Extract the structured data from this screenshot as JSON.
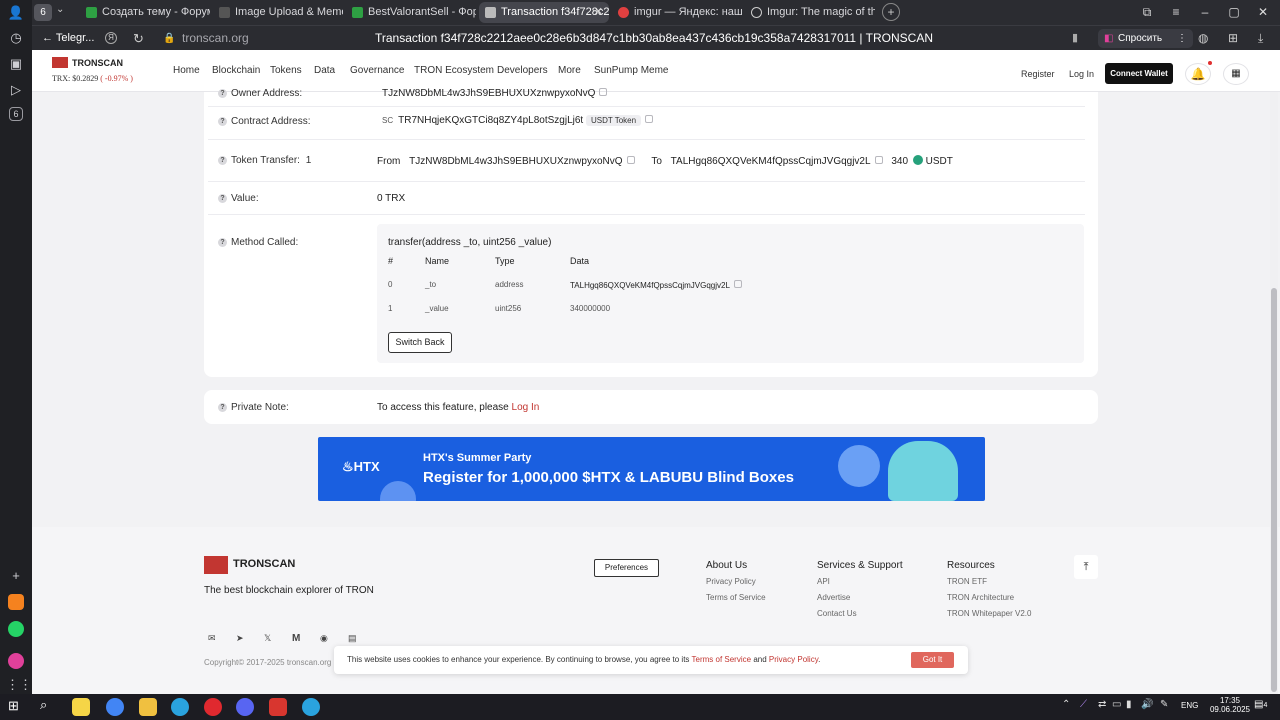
{
  "browser": {
    "tab_count": "6",
    "tabs": [
      {
        "label": "Создать тему - Форум со",
        "color": "#2ea043"
      },
      {
        "label": "Image Upload & Meme Ge",
        "color": "#555"
      },
      {
        "label": "BestValorantSell - Форум",
        "color": "#2ea043"
      },
      {
        "label": "Transaction f34f728c22",
        "color": "#aaa"
      },
      {
        "label": "imgur — Яндекс: нашлос",
        "color": "#e04040"
      },
      {
        "label": "Imgur: The magic of the In",
        "color": "#444"
      }
    ],
    "back_label": "Telegr...",
    "url": "tronscan.org",
    "page_title": "Transaction f34f728c2212aee0c28e6b3d847c1bb30ab8ea437c436cb19c358a7428317011 | TRONSCAN",
    "ask_button": "Спросить"
  },
  "site": {
    "logo": "TRONSCAN",
    "price_label": "TRX: $0.2829",
    "price_change": "( -0.97% )",
    "nav": [
      "Home",
      "Blockchain",
      "Tokens",
      "Data",
      "Governance",
      "TRON Ecosystem",
      "Developers",
      "More",
      "SunPump Meme"
    ],
    "register": "Register",
    "login": "Log In",
    "connect_wallet": "Connect Wallet"
  },
  "tx": {
    "owner_label": "Owner Address:",
    "owner_value": "TJzNW8DbML4w3JhS9EBHUXUXznwpyxoNvQ",
    "contract_label": "Contract Address:",
    "contract_prefix": "SC",
    "contract_value": "TR7NHqjeKQxGTCi8q8ZY4pL8otSzgjLj6t",
    "contract_tag": "USDT Token",
    "transfer_label": "Token Transfer:",
    "transfer_count": "1",
    "from_label": "From",
    "from_value": "TJzNW8DbML4w3JhS9EBHUXUXznwpyxoNvQ",
    "to_label": "To",
    "to_value": "TALHgq86QXQVeKM4fQpssCqjmJVGqgjv2L",
    "amount": "340",
    "token": "USDT",
    "value_label": "Value:",
    "value": "0 TRX",
    "method_label": "Method Called:",
    "method_sig": "transfer(address _to, uint256 _value)",
    "method_headers": [
      "#",
      "Name",
      "Type",
      "Data"
    ],
    "method_rows": [
      [
        "0",
        "_to",
        "address",
        "TALHgq86QXQVeKM4fQpssCqjmJVGqgjv2L"
      ],
      [
        "1",
        "_value",
        "uint256",
        "340000000"
      ]
    ],
    "switch_back": "Switch Back",
    "note_label": "Private Note:",
    "note_text": "To access this feature, please",
    "note_link": "Log In"
  },
  "banner": {
    "brand": "HTX",
    "line1": "HTX's Summer Party",
    "line2": "Register for 1,000,000 $HTX & LABUBU Blind Boxes"
  },
  "footer": {
    "logo": "TRONSCAN",
    "tagline": "The best blockchain explorer of TRON",
    "preferences": "Preferences",
    "about_h": "About Us",
    "about_links": [
      "Privacy Policy",
      "Terms of Service"
    ],
    "services_h": "Services & Support",
    "services_links": [
      "API",
      "Advertise",
      "Contact Us"
    ],
    "resources_h": "Resources",
    "resources_links": [
      "TRON ETF",
      "TRON Architecture",
      "TRON Whitepaper V2.0"
    ],
    "copyright": "Copyright© 2017-2025 tronscan.org"
  },
  "cookie": {
    "text": "This website uses cookies to enhance your experience. By continuing to browse, you agree to its",
    "terms": "Terms of Service",
    "and": "and",
    "privacy": "Privacy Policy",
    "period": ".",
    "button": "Got It"
  },
  "taskbar": {
    "lang": "ENG",
    "time": "17:35",
    "date": "09.06.2025",
    "notif": "4"
  },
  "colors": {
    "accent": "#c23631",
    "link": "#c23631",
    "banner": "#1a5fe0"
  }
}
